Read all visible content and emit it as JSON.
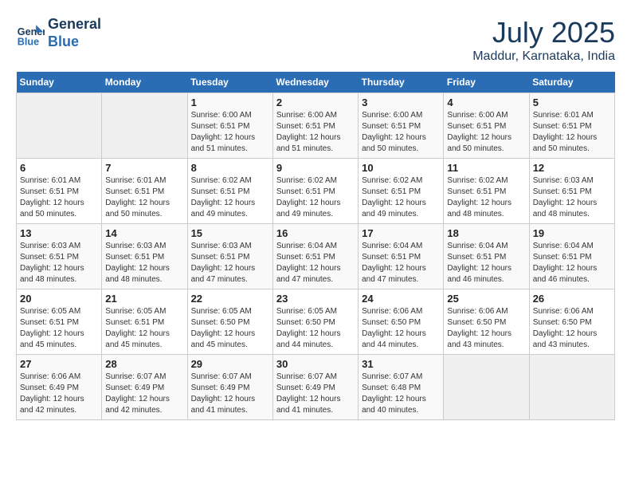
{
  "header": {
    "logo_line1": "General",
    "logo_line2": "Blue",
    "month": "July 2025",
    "location": "Maddur, Karnataka, India"
  },
  "weekdays": [
    "Sunday",
    "Monday",
    "Tuesday",
    "Wednesday",
    "Thursday",
    "Friday",
    "Saturday"
  ],
  "weeks": [
    [
      {
        "day": "",
        "info": ""
      },
      {
        "day": "",
        "info": ""
      },
      {
        "day": "1",
        "info": "Sunrise: 6:00 AM\nSunset: 6:51 PM\nDaylight: 12 hours and 51 minutes."
      },
      {
        "day": "2",
        "info": "Sunrise: 6:00 AM\nSunset: 6:51 PM\nDaylight: 12 hours and 51 minutes."
      },
      {
        "day": "3",
        "info": "Sunrise: 6:00 AM\nSunset: 6:51 PM\nDaylight: 12 hours and 50 minutes."
      },
      {
        "day": "4",
        "info": "Sunrise: 6:00 AM\nSunset: 6:51 PM\nDaylight: 12 hours and 50 minutes."
      },
      {
        "day": "5",
        "info": "Sunrise: 6:01 AM\nSunset: 6:51 PM\nDaylight: 12 hours and 50 minutes."
      }
    ],
    [
      {
        "day": "6",
        "info": "Sunrise: 6:01 AM\nSunset: 6:51 PM\nDaylight: 12 hours and 50 minutes."
      },
      {
        "day": "7",
        "info": "Sunrise: 6:01 AM\nSunset: 6:51 PM\nDaylight: 12 hours and 50 minutes."
      },
      {
        "day": "8",
        "info": "Sunrise: 6:02 AM\nSunset: 6:51 PM\nDaylight: 12 hours and 49 minutes."
      },
      {
        "day": "9",
        "info": "Sunrise: 6:02 AM\nSunset: 6:51 PM\nDaylight: 12 hours and 49 minutes."
      },
      {
        "day": "10",
        "info": "Sunrise: 6:02 AM\nSunset: 6:51 PM\nDaylight: 12 hours and 49 minutes."
      },
      {
        "day": "11",
        "info": "Sunrise: 6:02 AM\nSunset: 6:51 PM\nDaylight: 12 hours and 48 minutes."
      },
      {
        "day": "12",
        "info": "Sunrise: 6:03 AM\nSunset: 6:51 PM\nDaylight: 12 hours and 48 minutes."
      }
    ],
    [
      {
        "day": "13",
        "info": "Sunrise: 6:03 AM\nSunset: 6:51 PM\nDaylight: 12 hours and 48 minutes."
      },
      {
        "day": "14",
        "info": "Sunrise: 6:03 AM\nSunset: 6:51 PM\nDaylight: 12 hours and 48 minutes."
      },
      {
        "day": "15",
        "info": "Sunrise: 6:03 AM\nSunset: 6:51 PM\nDaylight: 12 hours and 47 minutes."
      },
      {
        "day": "16",
        "info": "Sunrise: 6:04 AM\nSunset: 6:51 PM\nDaylight: 12 hours and 47 minutes."
      },
      {
        "day": "17",
        "info": "Sunrise: 6:04 AM\nSunset: 6:51 PM\nDaylight: 12 hours and 47 minutes."
      },
      {
        "day": "18",
        "info": "Sunrise: 6:04 AM\nSunset: 6:51 PM\nDaylight: 12 hours and 46 minutes."
      },
      {
        "day": "19",
        "info": "Sunrise: 6:04 AM\nSunset: 6:51 PM\nDaylight: 12 hours and 46 minutes."
      }
    ],
    [
      {
        "day": "20",
        "info": "Sunrise: 6:05 AM\nSunset: 6:51 PM\nDaylight: 12 hours and 45 minutes."
      },
      {
        "day": "21",
        "info": "Sunrise: 6:05 AM\nSunset: 6:51 PM\nDaylight: 12 hours and 45 minutes."
      },
      {
        "day": "22",
        "info": "Sunrise: 6:05 AM\nSunset: 6:50 PM\nDaylight: 12 hours and 45 minutes."
      },
      {
        "day": "23",
        "info": "Sunrise: 6:05 AM\nSunset: 6:50 PM\nDaylight: 12 hours and 44 minutes."
      },
      {
        "day": "24",
        "info": "Sunrise: 6:06 AM\nSunset: 6:50 PM\nDaylight: 12 hours and 44 minutes."
      },
      {
        "day": "25",
        "info": "Sunrise: 6:06 AM\nSunset: 6:50 PM\nDaylight: 12 hours and 43 minutes."
      },
      {
        "day": "26",
        "info": "Sunrise: 6:06 AM\nSunset: 6:50 PM\nDaylight: 12 hours and 43 minutes."
      }
    ],
    [
      {
        "day": "27",
        "info": "Sunrise: 6:06 AM\nSunset: 6:49 PM\nDaylight: 12 hours and 42 minutes."
      },
      {
        "day": "28",
        "info": "Sunrise: 6:07 AM\nSunset: 6:49 PM\nDaylight: 12 hours and 42 minutes."
      },
      {
        "day": "29",
        "info": "Sunrise: 6:07 AM\nSunset: 6:49 PM\nDaylight: 12 hours and 41 minutes."
      },
      {
        "day": "30",
        "info": "Sunrise: 6:07 AM\nSunset: 6:49 PM\nDaylight: 12 hours and 41 minutes."
      },
      {
        "day": "31",
        "info": "Sunrise: 6:07 AM\nSunset: 6:48 PM\nDaylight: 12 hours and 40 minutes."
      },
      {
        "day": "",
        "info": ""
      },
      {
        "day": "",
        "info": ""
      }
    ]
  ]
}
